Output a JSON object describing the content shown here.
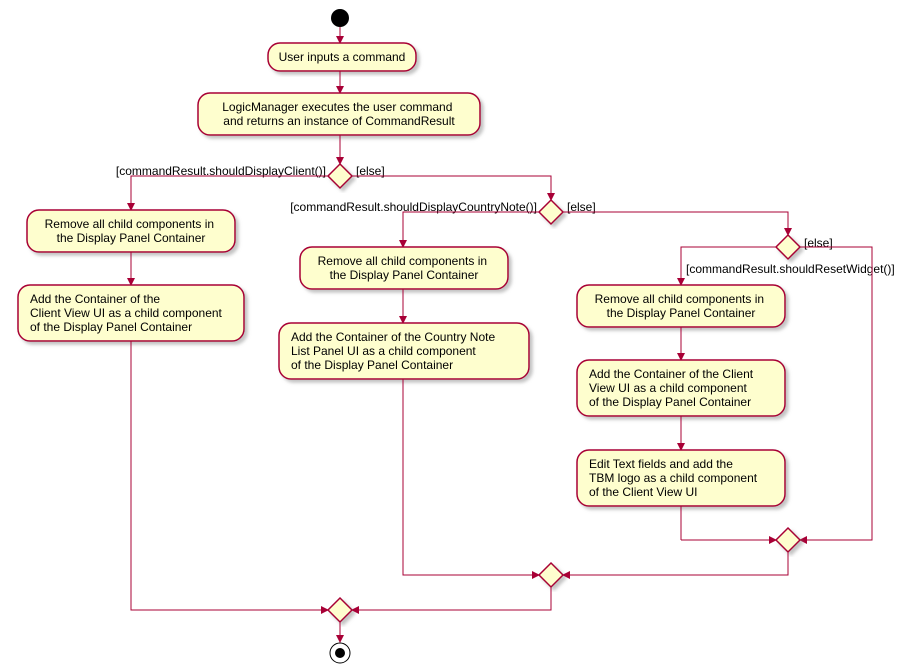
{
  "chart_data": {
    "type": "activity-diagram",
    "title": "",
    "nodes": {
      "start": "",
      "n1": "User inputs a command",
      "n2": "LogicManager executes the user command\nand returns an instance of CommandResult",
      "d1": {
        "left": "[commandResult.shouldDisplayClient()]",
        "right": "[else]"
      },
      "b1a": "Remove all child components in\nthe Display Panel Container",
      "b1b": "Add the Container of the\nClient View UI as a child component\nof the Display Panel Container",
      "d2": {
        "left": "[commandResult.shouldDisplayCountryNote()]",
        "right": "[else]"
      },
      "b2a": "Remove all child components in\nthe Display Panel Container",
      "b2b": "Add the Container of the Country Note\nList Panel UI as a child component\nof the Display Panel Container",
      "d3": {
        "left": "[commandResult.shouldResetWidget()]",
        "right": "[else]"
      },
      "b3a": "Remove all child components in\nthe Display Panel Container",
      "b3b": "Add the Container of the Client\nView UI as a child component\nof the Display Panel Container",
      "b3c": "Edit Text fields and add the\nTBM logo as a child component\nof the Client View UI",
      "end": ""
    }
  }
}
